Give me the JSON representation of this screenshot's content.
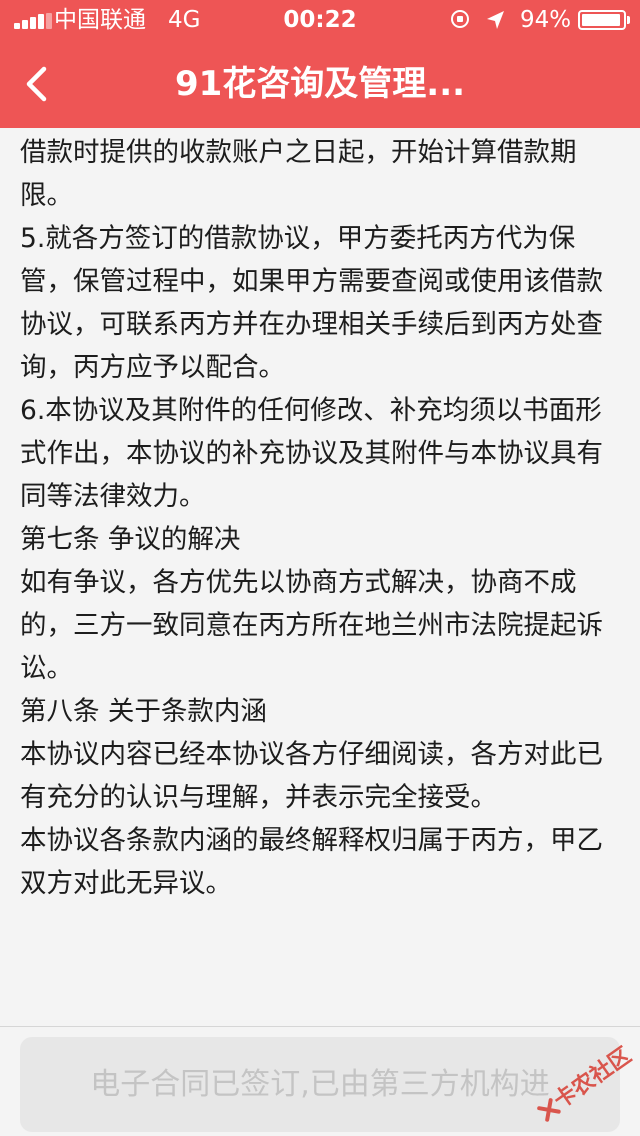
{
  "status_bar": {
    "carrier": "中国联通",
    "network": "4G",
    "time": "00:22",
    "battery_percent_label": "94%",
    "battery_level": 0.94
  },
  "nav": {
    "title": "91花咨询及管理..."
  },
  "contract": {
    "paragraphs": [
      "借款时提供的收款账户之日起，开始计算借款期限。",
      "5.就各方签订的借款协议，甲方委托丙方代为保管，保管过程中，如果甲方需要查阅或使用该借款协议，可联系丙方并在办理相关手续后到丙方处查询，丙方应予以配合。",
      "6.本协议及其附件的任何修改、补充均须以书面形式作出，本协议的补充协议及其附件与本协议具有同等法律效力。",
      "第七条 争议的解决",
      "如有争议，各方优先以协商方式解决，协商不成的，三方一致同意在丙方所在地兰州市法院提起诉讼。",
      "第八条 关于条款内涵",
      "本协议内容已经本协议各方仔细阅读，各方对此已有充分的认识与理解，并表示完全接受。",
      "本协议各条款内涵的最终解释权归属于丙方，甲乙双方对此无异议。"
    ]
  },
  "footer": {
    "button_label": "电子合同已签订,已由第三方机构进"
  },
  "watermark": {
    "text": "卡农社区"
  },
  "colors": {
    "header": "#ee5555",
    "text": "#1d1d1d",
    "disabled_button_bg": "#e7e7e7",
    "disabled_button_text": "#c4c4c4"
  },
  "icons": [
    "signal-icon",
    "lock-rotation-icon",
    "location-arrow-icon",
    "battery-icon",
    "back-chevron-icon"
  ]
}
